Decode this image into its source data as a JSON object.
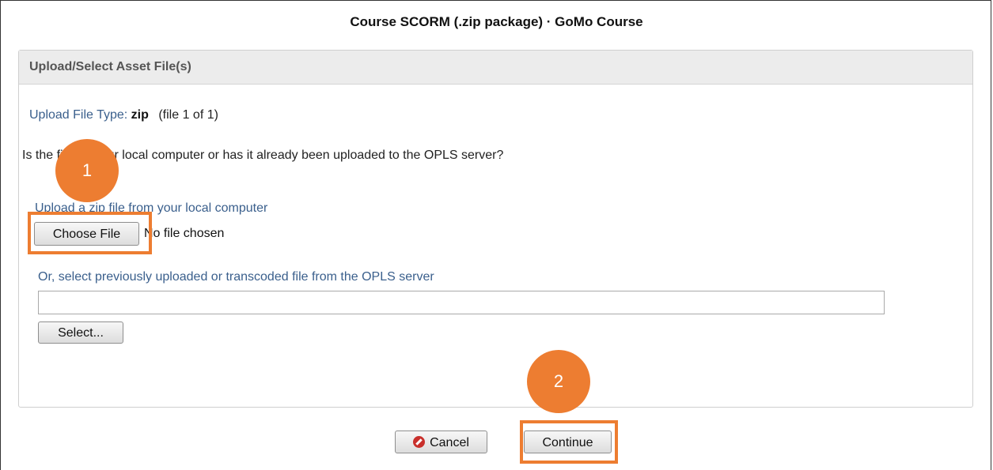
{
  "dialog": {
    "title": "Course SCORM (.zip package) · GoMo Course"
  },
  "panel": {
    "header": "Upload/Select Asset File(s)",
    "file_type_label": "Upload File Type:",
    "file_type_value": "zip",
    "file_count": "(file 1 of 1)",
    "question": "Is the file on your local computer or has it already been uploaded to the OPLS server?",
    "upload_label": "Upload a zip file from your local computer",
    "choose_file_label": "Choose File",
    "no_file_text": "No file chosen",
    "select_label": "Or, select previously uploaded or transcoded file from the OPLS server",
    "server_file_value": "",
    "select_button_label": "Select..."
  },
  "footer": {
    "cancel_label": "Cancel",
    "continue_label": "Continue"
  },
  "annotations": {
    "step1": "1",
    "step2": "2",
    "color": "#ed7d31"
  },
  "icons": {
    "cancel": "cancel-circle-icon"
  }
}
